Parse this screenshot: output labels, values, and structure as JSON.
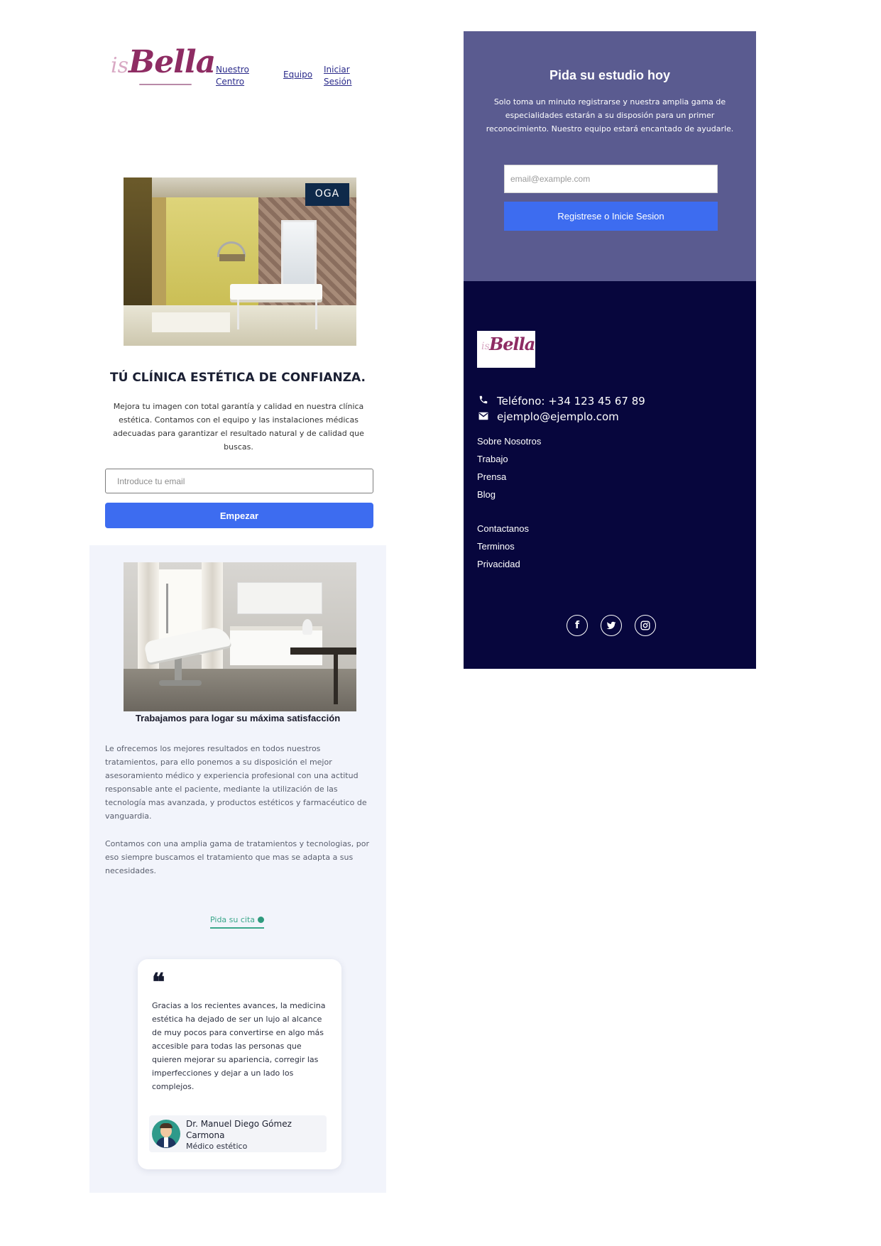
{
  "header": {
    "logo_is": "is",
    "logo_bella": "Bella",
    "nav": {
      "centro": "Nuestro Centro",
      "equipo": "Equipo",
      "sesion": "Iniciar Sesión"
    }
  },
  "hero": {
    "image_badge": "OGA",
    "title": "TÚ CLÍNICA ESTÉTICA DE CONFIANZA.",
    "text": "Mejora tu imagen con total garantía y calidad en nuestra clínica estética. Contamos con el equipo y las instalaciones médicas adecuadas para garantizar el resultado natural y de calidad que buscas.",
    "email_placeholder": "Introduce tu email",
    "button": "Empezar"
  },
  "about": {
    "title": "Trabajamos para logar su máxima satisfacción",
    "paragraph1": "Le ofrecemos los mejores resultados en todos nuestros tratamientos, para ello ponemos a su disposición el mejor asesoramiento médico y experiencia profesional con una actitud responsable ante el paciente, mediante la utilización de las tecnología mas avanzada, y productos estéticos y farmacéutico de vanguardia.",
    "paragraph2": "Contamos con una amplia gama de tratamientos y tecnologias, por eso siempre buscamos el tratamiento que mas se adapta a sus necesidades.",
    "cta_link": "Pida su cita"
  },
  "testimonial": {
    "quote_mark": "❝",
    "text": "Gracias a los recientes avances, la medicina estética ha dejado de ser un lujo al alcance de muy pocos para convertirse en algo más accesible para todas las personas que quieren mejorar su apariencia, corregir las imperfecciones y dejar a un lado los complejos.",
    "author_name": "Dr. Manuel Diego Gómez Carmona",
    "author_role": "Médico estético"
  },
  "cta": {
    "title": "Pida su estudio hoy",
    "text": "Solo toma un minuto registrarse y nuestra amplia gama de especialidades estarán a su disposión para un primer reconocimiento. Nuestro equipo estará encantado de ayudarle.",
    "email_placeholder": "email@example.com",
    "button": "Registrese o Inicie Sesion"
  },
  "footer": {
    "logo_is": "is",
    "logo_bella": "Bella",
    "phone": "Teléfono: +34 123 45 67 89",
    "email": "ejemplo@ejemplo.com",
    "links_group1": [
      "Sobre Nosotros",
      "Trabajo",
      "Prensa",
      "Blog"
    ],
    "links_group2": [
      "Contactanos",
      "Terminos",
      "Privacidad"
    ],
    "social": {
      "facebook": "f"
    }
  },
  "colors": {
    "accent_blue": "#3d6cf0",
    "cta_bg": "#5a5b90",
    "footer_bg": "#07063d",
    "brand_magenta": "#8e2c63",
    "link_green": "#3aa78a",
    "section_bg": "#f2f4fb"
  },
  "icons": [
    "phone-icon",
    "mail-icon",
    "facebook-icon",
    "twitter-icon",
    "instagram-icon",
    "quote-icon"
  ]
}
